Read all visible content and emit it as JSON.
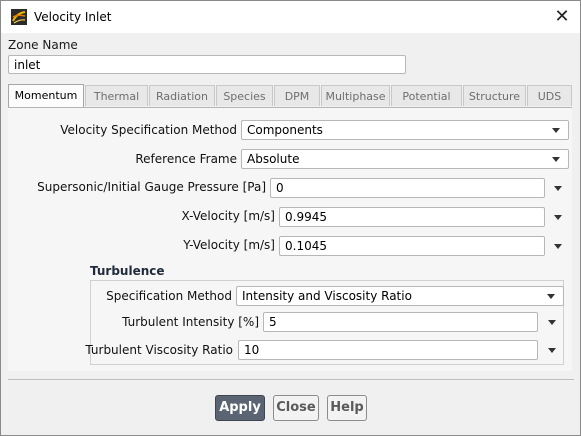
{
  "window": {
    "title": "Velocity Inlet",
    "close_icon": "close-icon",
    "app_icon": "fluent-app-icon"
  },
  "zone": {
    "label": "Zone Name",
    "value": "inlet"
  },
  "tabs": [
    {
      "label": "Momentum",
      "active": true
    },
    {
      "label": "Thermal",
      "active": false
    },
    {
      "label": "Radiation",
      "active": false
    },
    {
      "label": "Species",
      "active": false
    },
    {
      "label": "DPM",
      "active": false
    },
    {
      "label": "Multiphase",
      "active": false
    },
    {
      "label": "Potential",
      "active": false
    },
    {
      "label": "Structure",
      "active": false
    },
    {
      "label": "UDS",
      "active": false
    }
  ],
  "momentum": {
    "velocity_method": {
      "label": "Velocity Specification Method",
      "value": "Components"
    },
    "reference_frame": {
      "label": "Reference Frame",
      "value": "Absolute"
    },
    "gauge_pressure": {
      "label": "Supersonic/Initial Gauge Pressure [Pa]",
      "value": "0"
    },
    "x_velocity": {
      "label": "X-Velocity [m/s]",
      "value": "0.9945"
    },
    "y_velocity": {
      "label": "Y-Velocity [m/s]",
      "value": "0.1045"
    }
  },
  "turbulence": {
    "title": "Turbulence",
    "spec_method": {
      "label": "Specification Method",
      "value": "Intensity and Viscosity Ratio"
    },
    "intensity": {
      "label": "Turbulent Intensity [%]",
      "value": "5"
    },
    "viscosity_ratio": {
      "label": "Turbulent Viscosity Ratio",
      "value": "10"
    }
  },
  "buttons": {
    "apply": "Apply",
    "close": "Close",
    "help": "Help"
  },
  "colors": {
    "primary_button": "#5b6472",
    "dialog_bg": "#f0f0f0",
    "turbulence_heading": "#1f2a3a"
  }
}
